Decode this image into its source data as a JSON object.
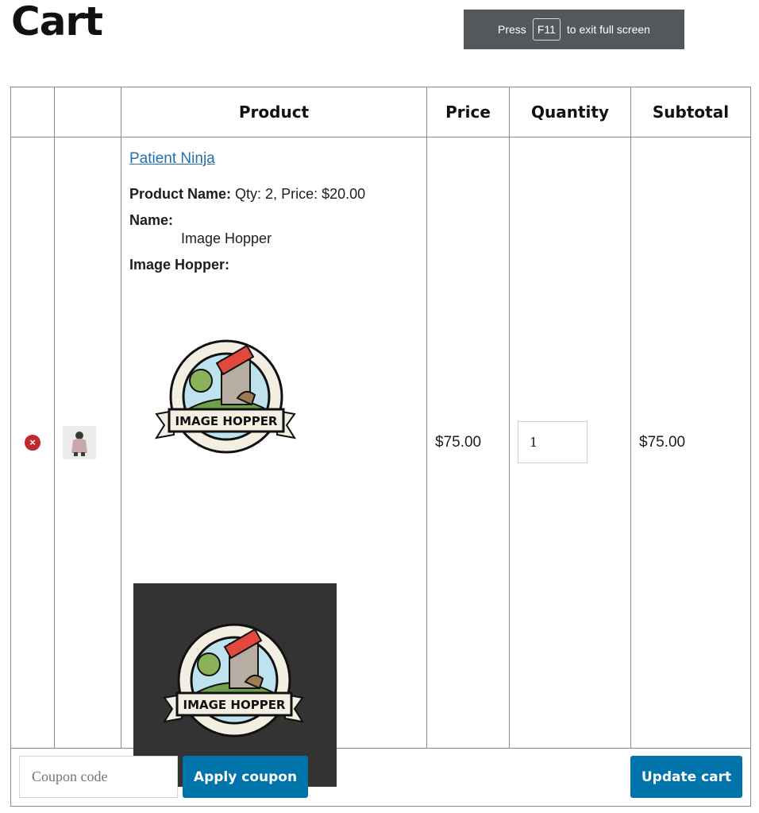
{
  "page": {
    "title": "Cart"
  },
  "fullscreen_notice": {
    "prefix": "Press",
    "key": "F11",
    "suffix": "to exit full screen"
  },
  "table": {
    "headers": {
      "remove": "",
      "thumbnail": "",
      "product": "Product",
      "price": "Price",
      "quantity": "Quantity",
      "subtotal": "Subtotal"
    }
  },
  "item": {
    "remove_symbol": "×",
    "product_name": "Patient Ninja",
    "meta": {
      "product_name_label": "Product Name:",
      "product_name_value": "Qty: 2, Price: $20.00",
      "name_label": "Name:",
      "name_value": "Image Hopper",
      "image_hopper_label": "Image Hopper:"
    },
    "logo_text": "IMAGE HOPPER",
    "price": "$75.00",
    "quantity": "1",
    "subtotal": "$75.00"
  },
  "actions": {
    "coupon_placeholder": "Coupon code",
    "apply_coupon_label": "Apply coupon",
    "update_cart_label": "Update cart"
  },
  "colors": {
    "button": "#0073aa",
    "link": "#2271b1",
    "remove": "#c0292c",
    "dark_box": "#333333"
  }
}
